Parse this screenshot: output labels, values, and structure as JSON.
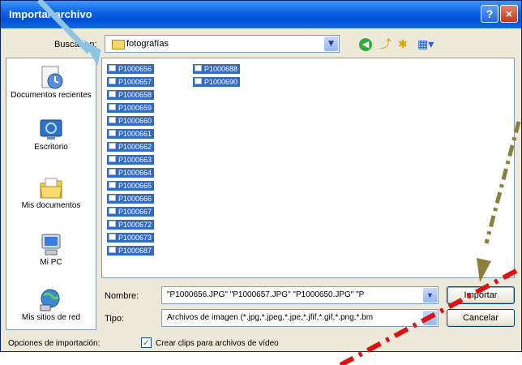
{
  "window": {
    "title": "Importar archivo"
  },
  "titlebar_buttons": {
    "help": "?",
    "close": "×"
  },
  "lookin": {
    "label": "Buscar en:",
    "value": "fotografías"
  },
  "toolbar_icons": [
    "back-icon",
    "up-folder-icon",
    "new-folder-icon",
    "views-menu-icon"
  ],
  "places": [
    {
      "label": "Documentos recientes",
      "icon": "recent-documents-icon"
    },
    {
      "label": "Escritorio",
      "icon": "desktop-icon"
    },
    {
      "label": "Mis documentos",
      "icon": "my-documents-icon"
    },
    {
      "label": "Mi PC",
      "icon": "my-computer-icon"
    },
    {
      "label": "Mis sitios de red",
      "icon": "network-places-icon"
    }
  ],
  "files": [
    "P1000656",
    "P1000657",
    "P1000658",
    "P1000659",
    "P1000660",
    "P1000661",
    "P1000662",
    "P1000663",
    "P1000664",
    "P1000665",
    "P1000666",
    "P1000667",
    "P1000672",
    "P1000673",
    "P1000687",
    "P1000688",
    "P1000690"
  ],
  "filename": {
    "label": "Nombre:",
    "value": "\"P1000656.JPG\" \"P1000657.JPG\" \"P1000650.JPG\" \"P"
  },
  "filetype": {
    "label": "Tipo:",
    "value": "Archivos de imagen (*.jpg,*.jpeg,*.jpe,*.jfif,*.gif,*.png,*.bm"
  },
  "buttons": {
    "import": "Importar",
    "cancel": "Cancelar"
  },
  "options": {
    "label": "Opciones de importación:",
    "checkbox_label": "Crear clips para archivos de vídeo",
    "checked": true
  },
  "annotation_colors": {
    "arrow_blue": "#8ec3e6",
    "arrow_olive": "#8c7f3a",
    "dash_red": "#e01010"
  }
}
